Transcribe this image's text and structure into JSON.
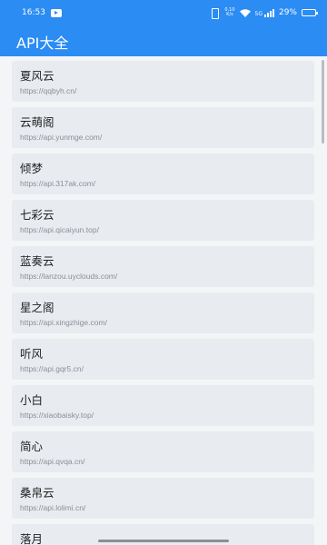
{
  "status_bar": {
    "time": "16:53",
    "net_speed_value": "0.10",
    "net_speed_unit": "K/s",
    "signal_label": "5G",
    "battery": "29%",
    "battery_level": 0.29
  },
  "app_bar": {
    "title": "API大全"
  },
  "apis": [
    {
      "name": "夏风云",
      "url": "https://qqbyh.cn/"
    },
    {
      "name": "云萌阁",
      "url": "https://api.yunmge.com/"
    },
    {
      "name": "倾梦",
      "url": "https://api.317ak.com/"
    },
    {
      "name": "七彩云",
      "url": "https://api.qicaiyun.top/"
    },
    {
      "name": "蓝奏云",
      "url": "https://lanzou.uyclouds.com/"
    },
    {
      "name": "星之阁",
      "url": "https://api.xingzhige.com/"
    },
    {
      "name": "听风",
      "url": "https://api.gqr5.cn/"
    },
    {
      "name": "小白",
      "url": "https://xiaobaisky.top/"
    },
    {
      "name": "简心",
      "url": "https://api.qvqa.cn/"
    },
    {
      "name": "桑帛云",
      "url": "https://api.lolimi.cn/"
    },
    {
      "name": "落月",
      "url": ""
    }
  ],
  "icons": {
    "notification": "video-notification-icon",
    "vibrate": "vibrate-icon",
    "wifi": "wifi-icon",
    "signal": "cellular-signal-icon",
    "battery": "battery-icon"
  },
  "colors": {
    "primary": "#2b8cf3",
    "card_bg": "#e8ecf0",
    "page_bg": "#f4f5f7",
    "url_text": "#8b8f96"
  }
}
